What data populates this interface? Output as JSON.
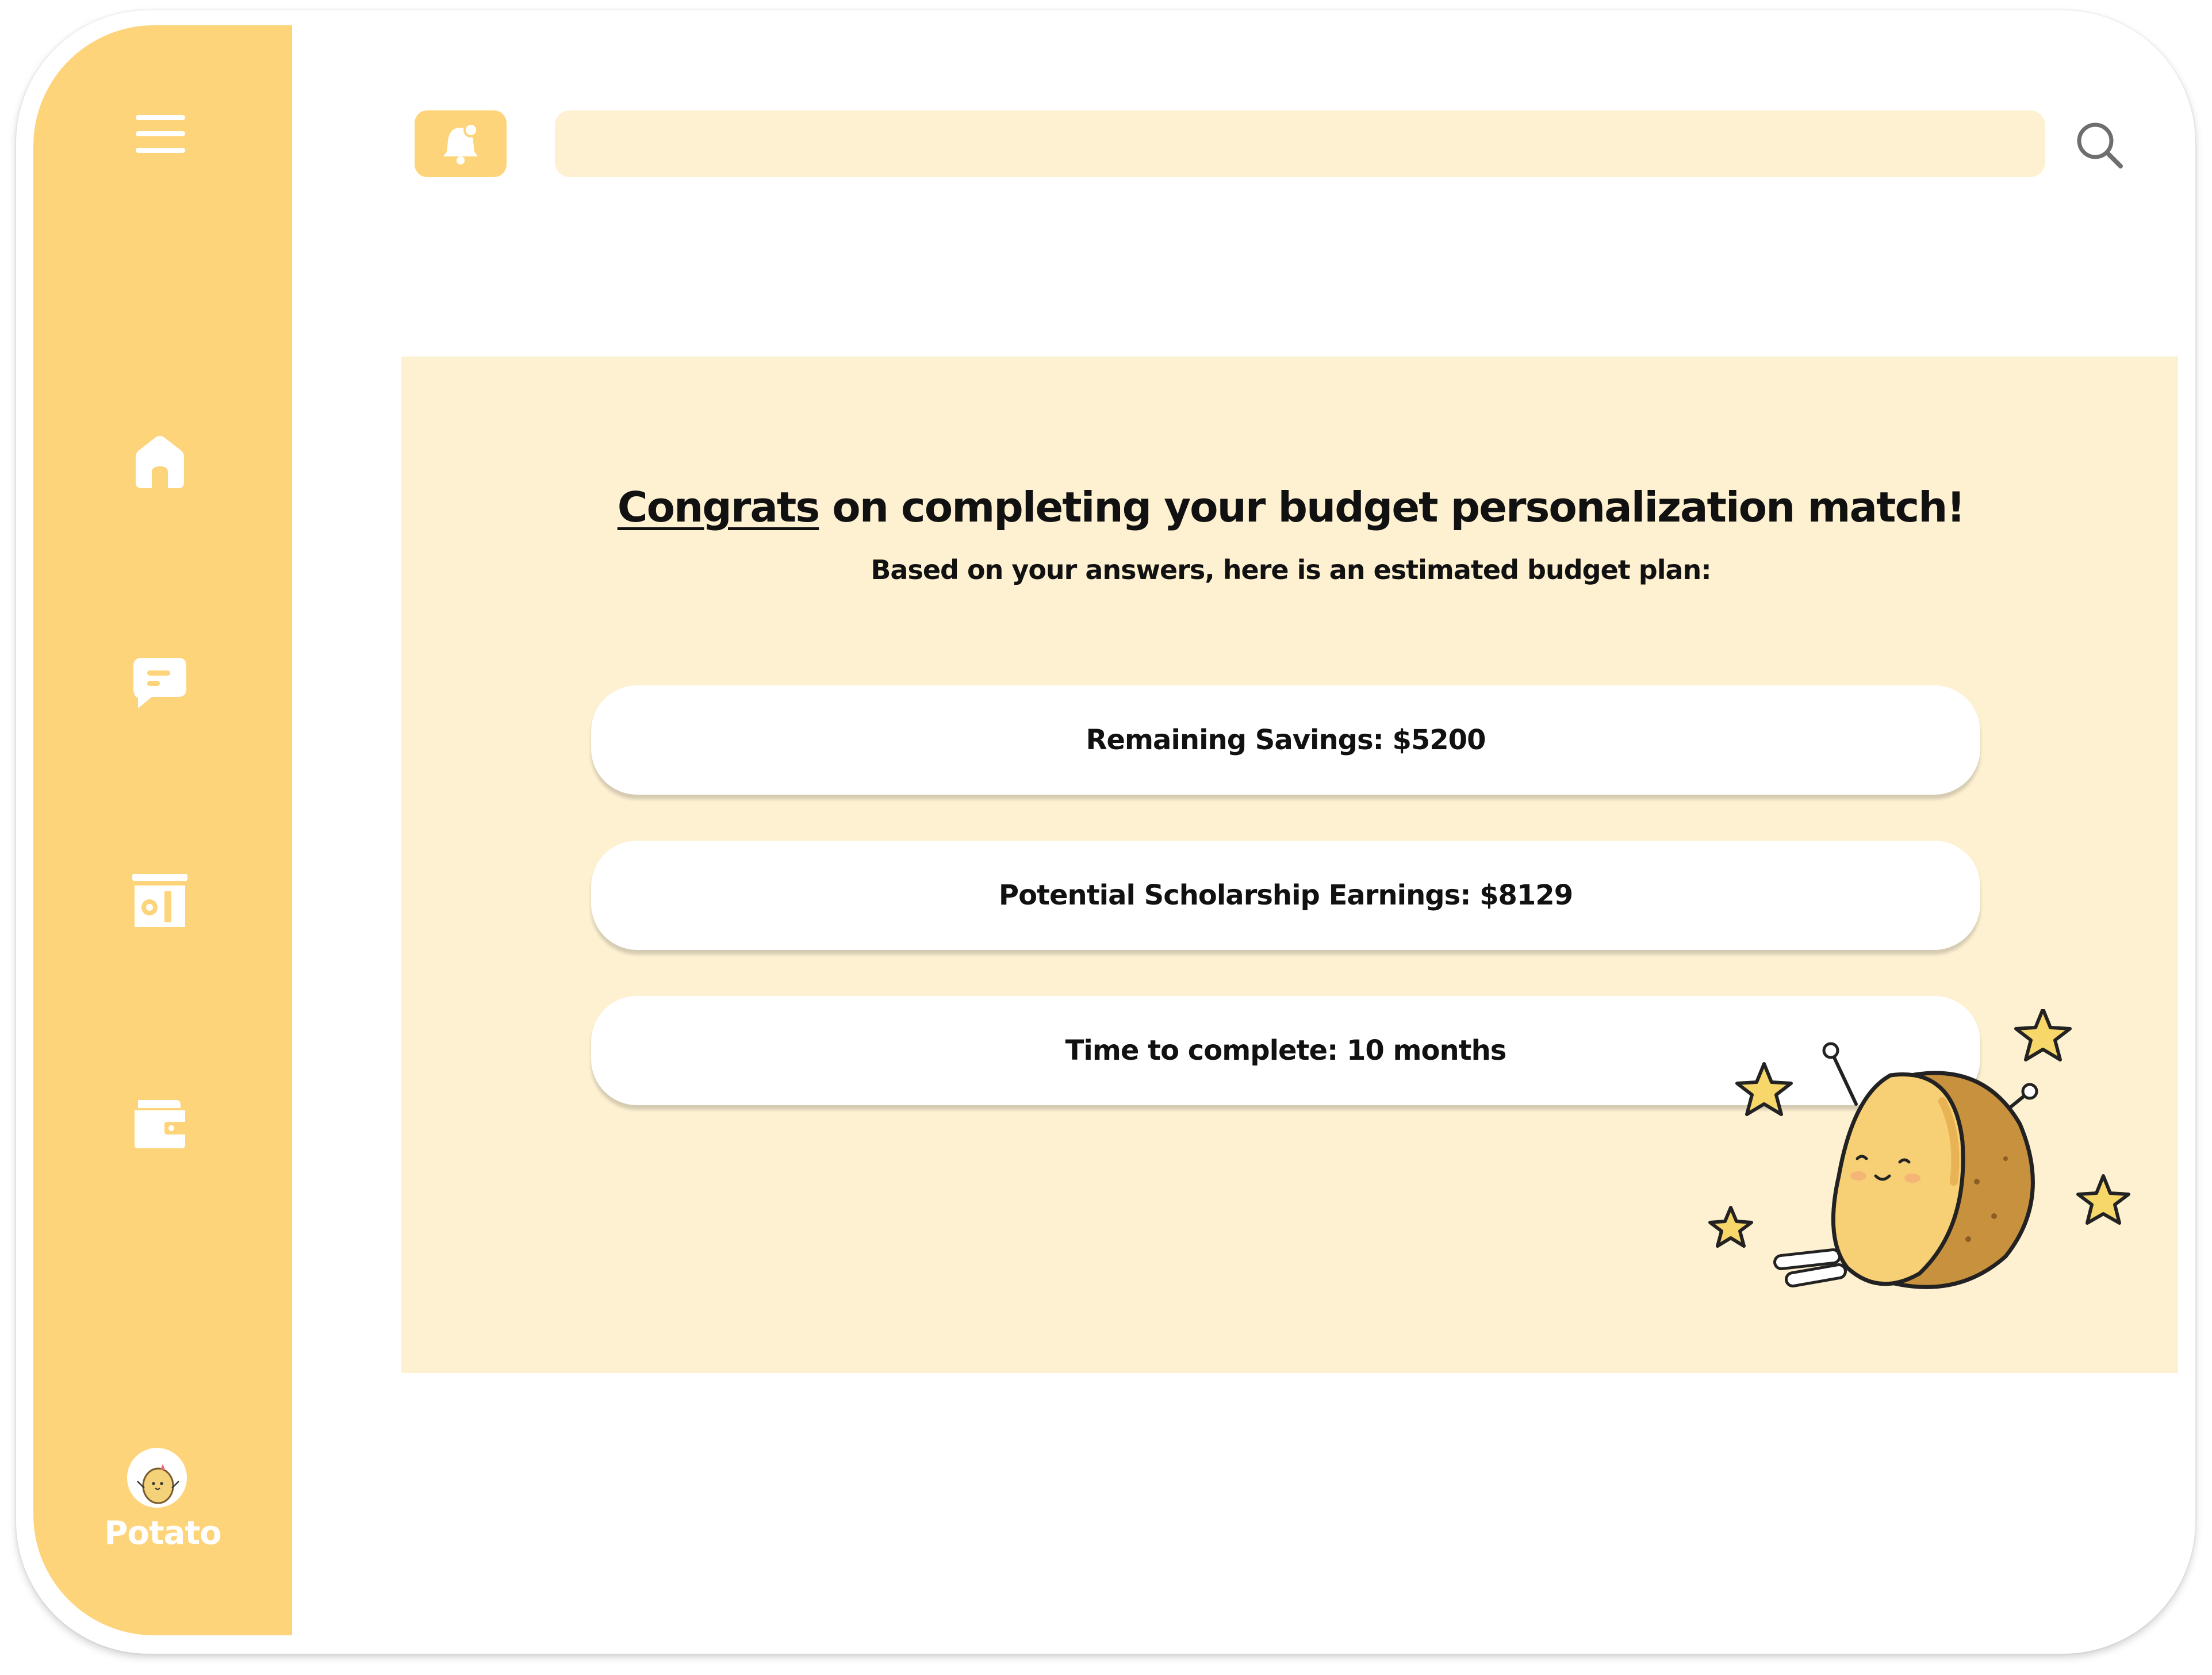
{
  "sidebar": {
    "menu_icon": "hamburger-menu-icon",
    "items": [
      {
        "icon": "home-icon"
      },
      {
        "icon": "chat-icon"
      },
      {
        "icon": "budget-icon"
      },
      {
        "icon": "wallet-icon"
      }
    ],
    "user": {
      "name": "Potato",
      "avatar": "potato-avatar"
    }
  },
  "topbar": {
    "bell_icon": "bell-icon",
    "search": {
      "placeholder": "",
      "value": ""
    },
    "search_icon": "search-icon"
  },
  "main": {
    "headline_highlight": "Congrats",
    "headline_rest": " on completing your budget personalization match!",
    "subheadline": "Based on your answers, here is an estimated budget plan:",
    "results": [
      "Remaining Savings: $5200",
      "Potential Scholarship Earnings: $8129",
      "Time to complete: 10 months"
    ],
    "illustration": "celebrating-potato"
  },
  "colors": {
    "sidebar": "#fdd47a",
    "panel": "#fdf1d2",
    "card": "#ffffff",
    "icon": "#ffffff",
    "star": "#f7d66a"
  }
}
